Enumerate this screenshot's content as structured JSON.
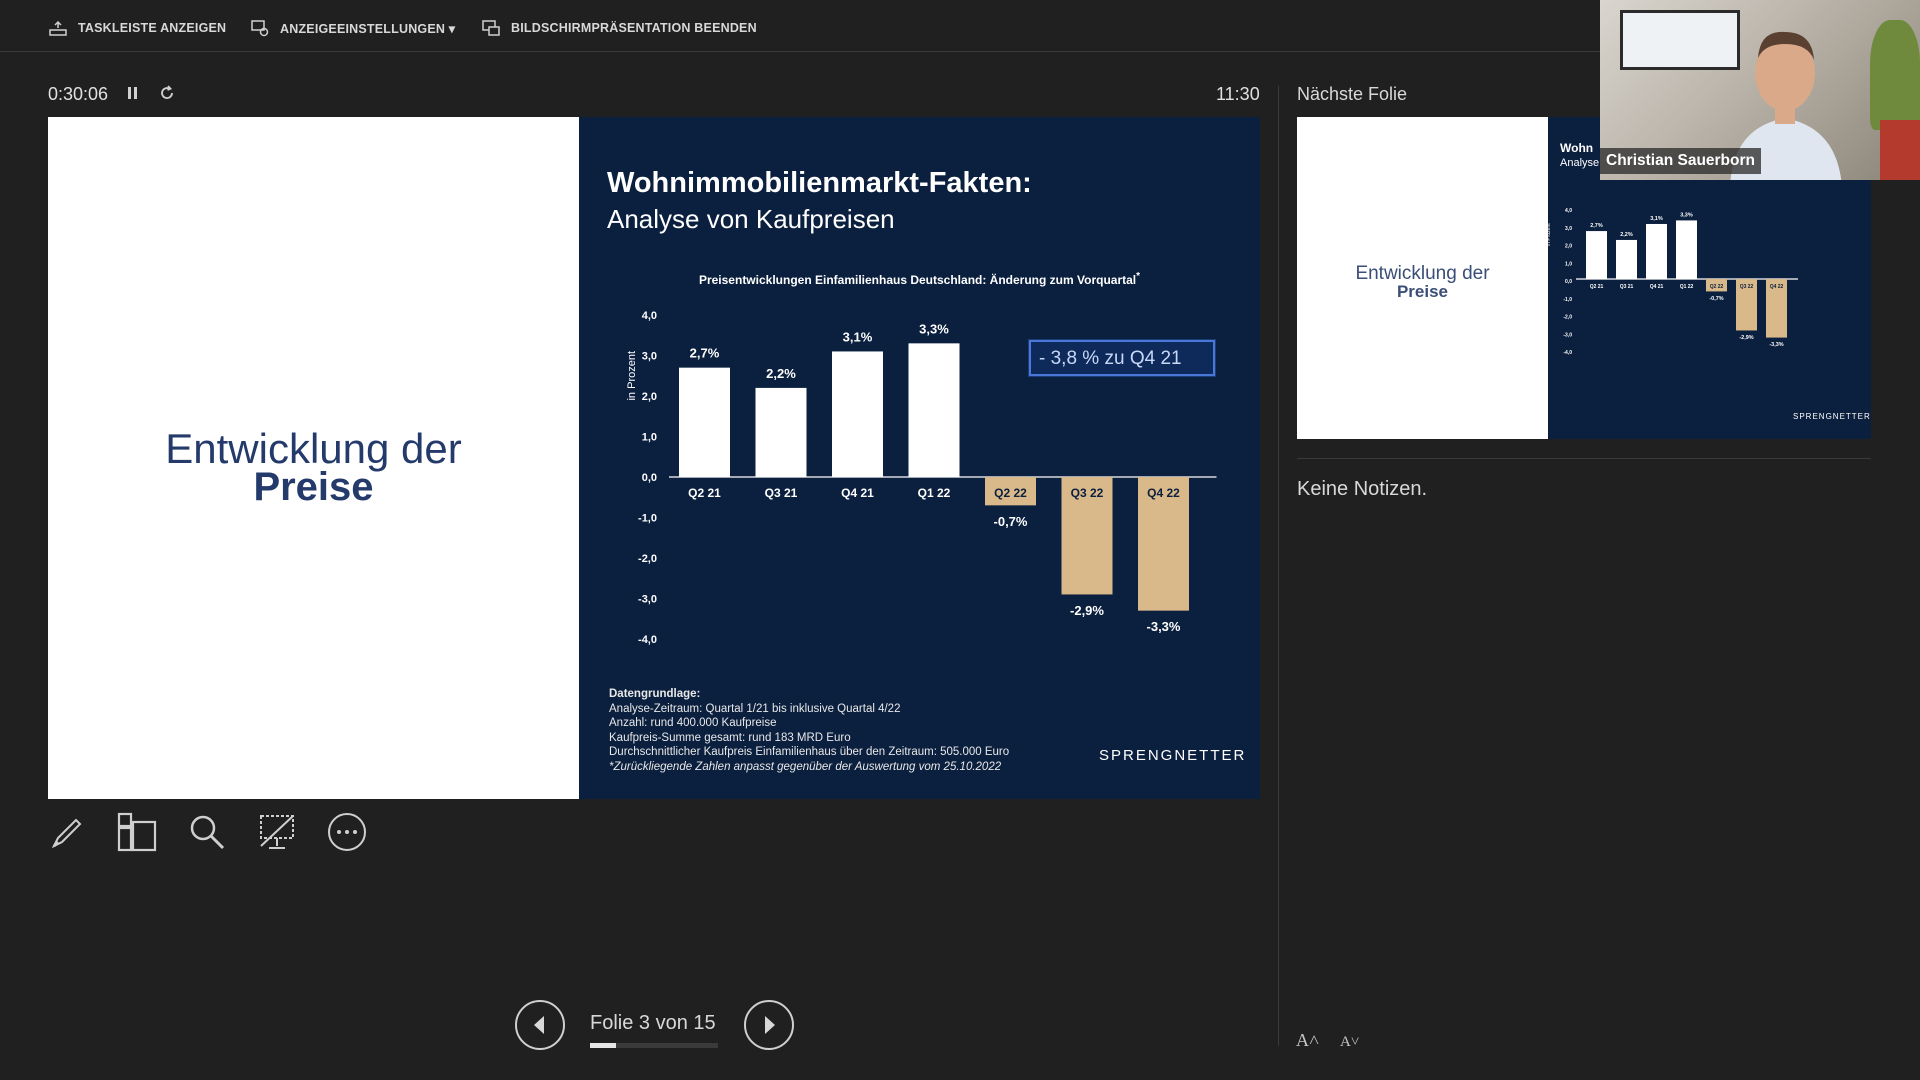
{
  "toolbar": {
    "show_taskbar": "TASKLEISTE ANZEIGEN",
    "display_settings": "ANZEIGEEINSTELLUNGEN ▾",
    "end_show": "BILDSCHIRMPRÄSENTATION BEENDEN"
  },
  "presenter": {
    "timer": "0:30:06",
    "clock": "11:30",
    "next_slide_label": "Nächste Folie",
    "notes": "Keine Notizen.",
    "slide_counter": "Folie 3 von 15",
    "progress_fraction": 0.2
  },
  "current_slide": {
    "left_title_line1": "Entwicklung der",
    "left_title_line2": "Preise",
    "title": "Wohnimmobilienmarkt-Fakten:",
    "subtitle": "Analyse von Kaufpreisen",
    "callout": "- 3,8 % zu Q4 21",
    "data_basis": {
      "heading": "Datengrundlage",
      "lines": [
        "Analyse-Zeitraum: Quartal 1/21 bis inklusive Quartal 4/22",
        "Anzahl: rund 400.000 Kaufpreise",
        "Kaufpreis-Summe gesamt: rund 183 MRD Euro",
        "Durchschnittlicher Kaufpreis Einfamilienhaus über den Zeitraum: 505.000 Euro"
      ],
      "footnote": "*Zurückliegende Zahlen anpasst gegenüber der Auswertung vom 25.10.2022"
    },
    "brand": "SPRENGNETTER"
  },
  "chart_data": {
    "type": "bar",
    "title": "Preisentwicklungen Einfamilienhaus Deutschland: Änderung zum Vorquartal",
    "title_suffix": "*",
    "ylabel": "in Prozent",
    "ylim": [
      -4.0,
      4.0
    ],
    "yticks": [
      "4,0",
      "3,0",
      "2,0",
      "1,0",
      "0,0",
      "-1,0",
      "-2,0",
      "-3,0",
      "-4,0"
    ],
    "categories": [
      "Q2 21",
      "Q3 21",
      "Q4 21",
      "Q1 22",
      "Q2 22",
      "Q3 22",
      "Q4 22"
    ],
    "values": [
      2.7,
      2.2,
      3.1,
      3.3,
      -0.7,
      -2.9,
      -3.3
    ],
    "labels": [
      "2,7%",
      "2,2%",
      "3,1%",
      "3,3%",
      "-0,7%",
      "-2,9%",
      "-3,3%"
    ],
    "colors": {
      "positive": "#ffffff",
      "negative": "#d9b98a"
    }
  },
  "next_slide": {
    "left_line1": "Entwicklung der",
    "left_line2": "Preise",
    "title": "Wohn",
    "subtitle": "Analyse",
    "brand": "SPRENGNETTER"
  },
  "video": {
    "name": "Christian Sauerborn"
  },
  "font_buttons": {
    "increase": "A˄",
    "decrease": "A˅"
  },
  "colors": {
    "background": "#202020",
    "slide_navy": "#0b1f3e",
    "accent_blue": "#243a6b"
  }
}
